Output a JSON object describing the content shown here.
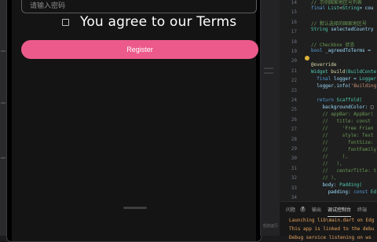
{
  "emulator": {
    "password_placeholder": "请输入密码",
    "agree_text": "You agree to our Terms",
    "register_label": "Register"
  },
  "middle_panel": {
    "faint_text": "当前运行"
  },
  "editor": {
    "line_numbers": [
      "14",
      "15",
      "16",
      "17",
      "18",
      "19",
      "20",
      "21",
      "22",
      "23",
      "24",
      "25",
      "26",
      "27",
      "28",
      "29",
      "30",
      "31",
      "32",
      "33",
      "34"
    ],
    "lines": [
      [
        {
          "t": "// 示例国家地区号列表",
          "c": "c-comment"
        }
      ],
      [
        {
          "t": "final ",
          "c": "c-kw"
        },
        {
          "t": "List",
          "c": "c-type"
        },
        {
          "t": "<",
          "c": "c-plain"
        },
        {
          "t": "String",
          "c": "c-type"
        },
        {
          "t": "> cou",
          "c": "c-var"
        }
      ],
      [
        {
          "t": "",
          "c": "c-plain"
        }
      ],
      [
        {
          "t": "// 默认选择的国家地区号",
          "c": "c-comment"
        }
      ],
      [
        {
          "t": "String ",
          "c": "c-type"
        },
        {
          "t": "selectedCountry",
          "c": "c-var"
        }
      ],
      [
        {
          "t": "",
          "c": "c-plain"
        }
      ],
      [
        {
          "t": "// Checkbox 状态",
          "c": "c-comment"
        }
      ],
      [
        {
          "t": "bool ",
          "c": "c-kw"
        },
        {
          "t": "_agreedToTerms = ",
          "c": "c-var"
        }
      ],
      [
        {
          "t": "",
          "c": "c-plain"
        }
      ],
      [
        {
          "t": "@override",
          "c": "c-dec"
        }
      ],
      [
        {
          "t": "Widget ",
          "c": "c-type"
        },
        {
          "t": "build",
          "c": "c-dec"
        },
        {
          "t": "(BuildConte",
          "c": "c-type"
        }
      ],
      [
        {
          "t": "  final ",
          "c": "c-kw"
        },
        {
          "t": "logger = ",
          "c": "c-var"
        },
        {
          "t": "Logger",
          "c": "c-type"
        }
      ],
      [
        {
          "t": "  logger.info(",
          "c": "c-var"
        },
        {
          "t": "'Building",
          "c": "c-str"
        }
      ],
      [
        {
          "t": "",
          "c": "c-plain"
        }
      ],
      [
        {
          "t": "  return ",
          "c": "c-kw"
        },
        {
          "t": "Scaffold(",
          "c": "c-type"
        }
      ],
      [
        {
          "t": "    backgroundColor: ",
          "c": "c-var"
        },
        {
          "t": "□",
          "c": "c-plain"
        }
      ],
      [
        {
          "t": "    // appBar: AppBar(",
          "c": "c-comment"
        }
      ],
      [
        {
          "t": "    //   title: const",
          "c": "c-comment"
        }
      ],
      [
        {
          "t": "    //     'Free Frien",
          "c": "c-comment"
        }
      ],
      [
        {
          "t": "    //     style: Text",
          "c": "c-comment"
        }
      ],
      [
        {
          "t": "    //       fontSize:",
          "c": "c-comment"
        }
      ],
      [
        {
          "t": "    //       fontFamily",
          "c": "c-comment"
        }
      ],
      [
        {
          "t": "    //     ),",
          "c": "c-comment"
        }
      ],
      [
        {
          "t": "    //   ),",
          "c": "c-comment"
        }
      ],
      [
        {
          "t": "    //   centerTitle: t",
          "c": "c-comment"
        }
      ],
      [
        {
          "t": "    // ),",
          "c": "c-comment"
        }
      ],
      [
        {
          "t": "    body: ",
          "c": "c-var"
        },
        {
          "t": "Padding(",
          "c": "c-type"
        }
      ],
      [
        {
          "t": "      padding: ",
          "c": "c-var"
        },
        {
          "t": "const ",
          "c": "c-kw"
        },
        {
          "t": "Ed",
          "c": "c-type"
        }
      ]
    ]
  },
  "panel": {
    "tabs": [
      "问题",
      "7",
      "输出",
      "调试控制台",
      "终端"
    ],
    "terminal_lines": [
      "Launching lib\\main.dart on Edg",
      "This app is linked to the debu",
      "Debug service listening on ws"
    ]
  }
}
